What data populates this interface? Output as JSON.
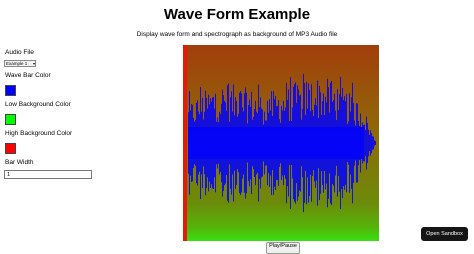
{
  "page": {
    "title": "Wave Form Example",
    "subtitle": "Display wave form and spectrograph as background of MP3 Audio file"
  },
  "controls": {
    "audio_file_label": "Audio File",
    "audio_file_selected": "Example 1",
    "wave_bar_color_label": "Wave Bar Color",
    "wave_bar_color": "#0000ff",
    "low_bg_color_label": "Low Background Color",
    "low_bg_color": "#00ff00",
    "high_bg_color_label": "High Background Color",
    "high_bg_color": "#ff0000",
    "bar_width_label": "Bar Width",
    "bar_width_value": "1"
  },
  "player": {
    "play_pause_label": "Play/Pause"
  },
  "sandbox": {
    "open_label": "Open Sandbox"
  }
}
